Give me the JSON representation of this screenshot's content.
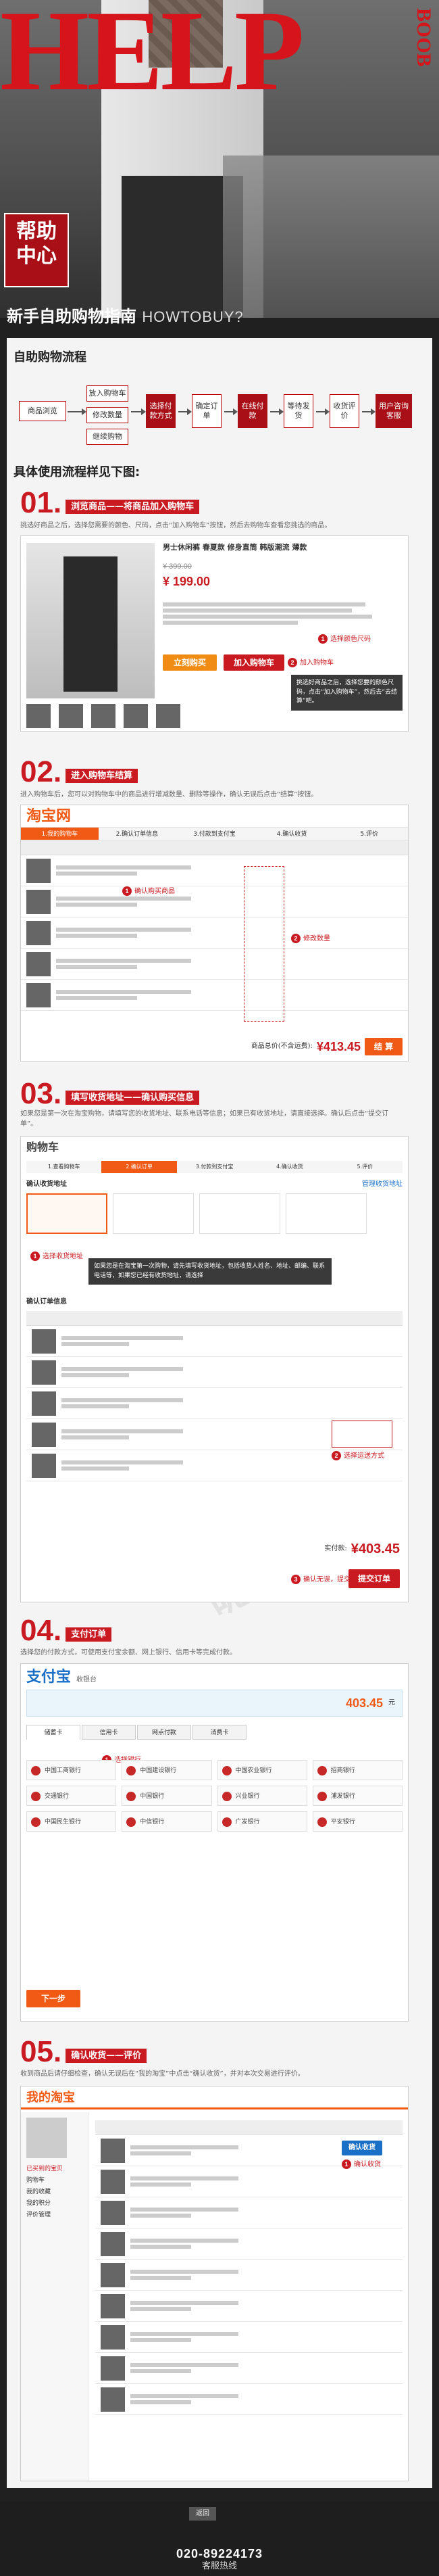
{
  "banner": {
    "big_text": "HELP",
    "sub_text": "BOOB",
    "badge_line1": "帮助",
    "badge_line2": "中心"
  },
  "guide": {
    "title": "新手自助购物指南",
    "title_en": "HOWTOBUY?"
  },
  "flow_section": {
    "title": "自助购物流程",
    "boxes": [
      "商品浏览",
      "放入购物车",
      "修改数量",
      "继续购物",
      "选择付款方式",
      "确定订单",
      "在线付款",
      "等待发货",
      "收货评价",
      "用户咨询客服"
    ]
  },
  "detail_section": {
    "title": "具体使用流程样见下图:"
  },
  "steps": [
    {
      "num": "01.",
      "label": "浏览商品——将商品加入购物车",
      "desc": "挑选好商品之后，选择您需要的颜色、尺码，点击“加入购物车”按钮，然后去购物车查看您挑选的商品。"
    },
    {
      "num": "02.",
      "label": "进入购物车结算",
      "desc": "进入购物车后，您可以对购物车中的商品进行增减数量、删除等操作，确认无误后点击“结算”按钮。"
    },
    {
      "num": "03.",
      "label": "填写收货地址——确认购买信息",
      "desc": "如果您是第一次在淘宝购物，请填写您的收货地址、联系电话等信息；如果已有收货地址，请直接选择。确认后点击“提交订单”。"
    },
    {
      "num": "04.",
      "label": "支付订单",
      "desc": "选择您的付款方式，可使用支付宝余额、网上银行、信用卡等完成付款。"
    },
    {
      "num": "05.",
      "label": "确认收货——评价",
      "desc": "收到商品后请仔细检查，确认无误后在“我的淘宝”中点击“确认收货”，并对本次交易进行评价。"
    }
  ],
  "step1": {
    "product_title": "男士休闲裤 春夏款 修身直筒 韩版潮流 薄款",
    "price": "¥ 399.00",
    "promo_price": "¥ 199.00",
    "add_cart": "加入购物车",
    "buy_now": "立刻购买",
    "tip": "挑选好商品之后，选择您要的颜色尺码，点击“加入购物车”，然后去“去结算”吧。",
    "mark1": "选择颜色尺码",
    "mark2": "加入购物车"
  },
  "step2": {
    "logo": "淘宝网",
    "tabs": [
      "1.我的购物车",
      "2.确认订单信息",
      "3.付款到支付宝",
      "4.确认收货",
      "5.评价"
    ],
    "mark1": "确认购买商品",
    "mark2": "修改数量",
    "total_label": "商品总价(不含运费):",
    "total": "¥413.45",
    "checkout": "结 算",
    "mark3": "结算"
  },
  "step3": {
    "title": "购物车",
    "tabs": [
      "1.查看购物车",
      "2.确认订单",
      "3.付款到支付宝",
      "4.确认收货",
      "5.评价"
    ],
    "address_title": "确认收货地址",
    "manage": "管理收货地址",
    "tip": "如果您是在淘宝第一次购物，请先填写收货地址，包括收货人姓名、地址、邮编、联系电话等，如果您已经有收货地址，请选择",
    "order_title": "确认订单信息",
    "total_label": "实付款:",
    "total": "¥403.45",
    "submit": "提交订单",
    "mark1": "选择收货地址",
    "mark2": "选择运送方式",
    "mark3": "确认无误，提交订单"
  },
  "step4": {
    "logo": "支付宝",
    "logo_sub": "收银台",
    "amount": "403.45",
    "amount_unit": "元",
    "tabs": [
      "储蓄卡",
      "信用卡",
      "网点付款",
      "消费卡"
    ],
    "banks": [
      "中国工商银行",
      "中国建设银行",
      "中国农业银行",
      "招商银行",
      "交通银行",
      "中国银行",
      "兴业银行",
      "浦发银行",
      "中国民生银行",
      "中信银行",
      "广发银行",
      "平安银行"
    ],
    "mark1": "选择银行",
    "pay_button": "下一步"
  },
  "step5": {
    "logo": "我的淘宝",
    "menu": [
      "已买到的宝贝",
      "购物车",
      "我的收藏",
      "我的积分",
      "评价管理"
    ],
    "confirm": "确认收货",
    "mark1": "确认收货"
  },
  "footer": {
    "back": "返回",
    "phone": "020-89224173",
    "hotline": "客服热线"
  },
  "colors": {
    "accent": "#c81a20",
    "taobao_orange": "#f05a14",
    "alipay_blue": "#1a6fc7"
  }
}
